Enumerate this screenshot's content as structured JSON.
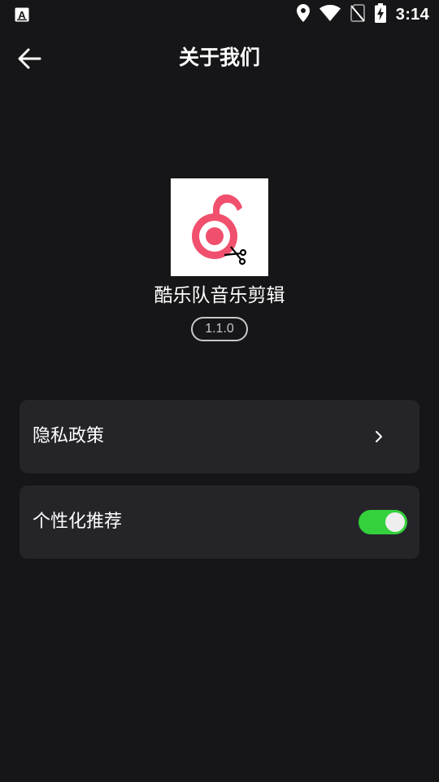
{
  "status_bar": {
    "time": "3:14",
    "icons": [
      "accessibility-a-icon",
      "location-icon",
      "wifi-icon",
      "no-sim-icon",
      "battery-charging-icon"
    ]
  },
  "header": {
    "title": "关于我们",
    "back_icon": "arrow-left-icon"
  },
  "app": {
    "name": "酷乐队音乐剪辑",
    "version": "1.1.0",
    "logo_icon": "music-note-scissors-icon"
  },
  "settings": {
    "privacy_label": "隐私政策",
    "privacy_icon": "chevron-right-icon",
    "recommend_label": "个性化推荐",
    "recommend_enabled": true
  },
  "colors": {
    "background": "#161618",
    "card": "#252529",
    "toggle_on": "#34d13c",
    "logo_accent": "#f0506e"
  }
}
